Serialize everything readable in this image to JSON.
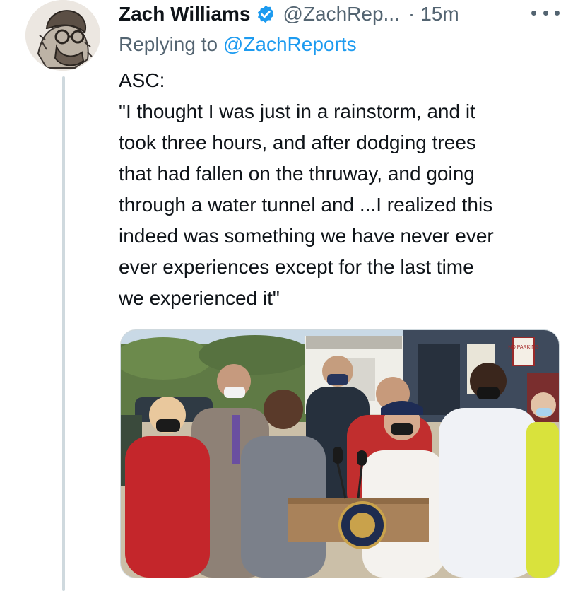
{
  "tweet": {
    "author_name": "Zach Williams",
    "handle": "@ZachRep...",
    "separator": "·",
    "time": "15m",
    "replying_prefix": "Replying to",
    "replying_to": "@ZachReports",
    "text_lines": [
      "ASC:",
      "\"I thought I was just in a rainstorm, and it",
      "took three hours, and after dodging trees",
      "that had fallen on the thruway, and going",
      "through a water tunnel and ...I realized this",
      "indeed was something we have never ever",
      "ever experiences except for the last time",
      "we experienced it\""
    ]
  },
  "media": {
    "sign_text": "NO PARKING"
  },
  "colors": {
    "text": "#0f1419",
    "secondary": "#536471",
    "link": "#1d9bf0",
    "thread_line": "#cfd9de"
  },
  "icons": {
    "verified": "verified-badge-icon",
    "more": "more-options-icon"
  }
}
